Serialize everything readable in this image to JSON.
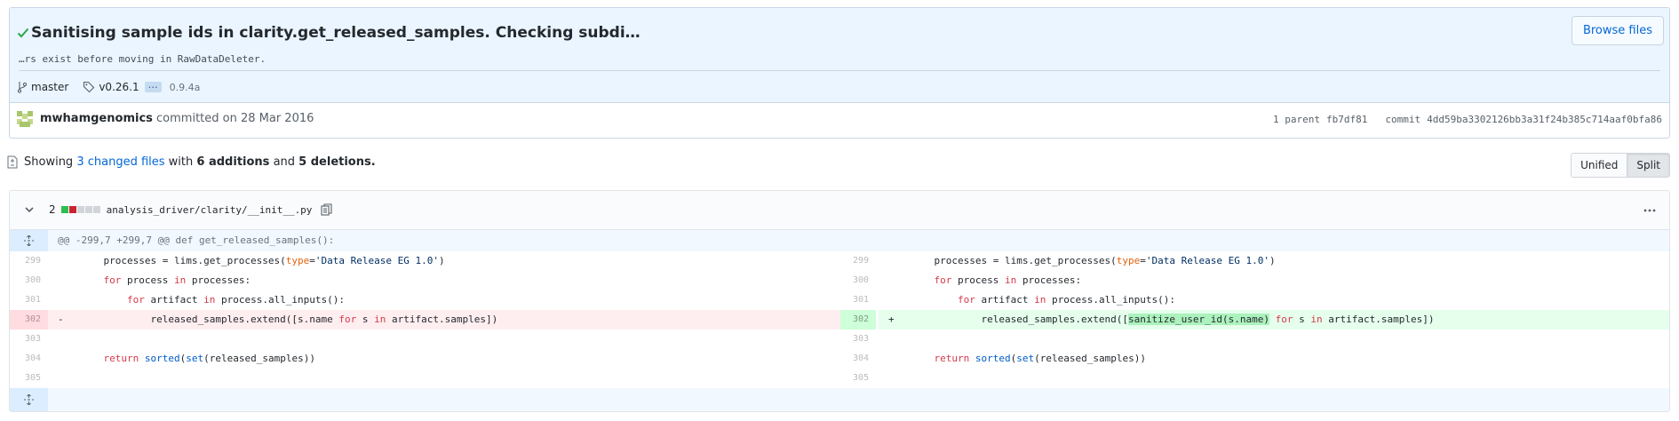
{
  "commit": {
    "title": "Sanitising sample ids in clarity.get_released_samples. Checking subdi…",
    "description": "…rs exist before moving in RawDataDeleter.",
    "browse_files_label": "Browse files",
    "branch": "master",
    "tag": "v0.26.1",
    "tag_ellipsis": "…",
    "tag_extra": "0.9.4a",
    "author": "mwhamgenomics",
    "committed_text": "committed on 28 Mar 2016",
    "parent_label": "1 parent",
    "parent_sha": "fb7df81",
    "commit_label": "commit",
    "commit_sha": "4dd59ba3302126bb3a31f24b385c714aaf0bfa86"
  },
  "toc": {
    "showing": "Showing",
    "changed_files": "3 changed files",
    "with": "with",
    "additions": "6 additions",
    "and": "and",
    "deletions": "5 deletions."
  },
  "view_toggle": {
    "unified": "Unified",
    "split": "Split",
    "selected": "Split"
  },
  "file": {
    "change_count": "2",
    "diffstat": [
      "added",
      "deleted",
      "neutral",
      "neutral",
      "neutral"
    ],
    "path": "analysis_driver/clarity/__init__.py",
    "hunk_header": "@@ -299,7 +299,7 @@ def get_released_samples():",
    "left_lines": [
      {
        "num": "299",
        "type": "context"
      },
      {
        "num": "300",
        "type": "context"
      },
      {
        "num": "301",
        "type": "context"
      },
      {
        "num": "302",
        "type": "del",
        "marker": "-"
      },
      {
        "num": "303",
        "type": "context"
      },
      {
        "num": "304",
        "type": "context"
      },
      {
        "num": "305",
        "type": "context"
      }
    ],
    "right_lines": [
      {
        "num": "299",
        "type": "context"
      },
      {
        "num": "300",
        "type": "context"
      },
      {
        "num": "301",
        "type": "context"
      },
      {
        "num": "302",
        "type": "add",
        "marker": "+"
      },
      {
        "num": "303",
        "type": "context"
      },
      {
        "num": "304",
        "type": "context"
      },
      {
        "num": "305",
        "type": "context"
      }
    ],
    "code": {
      "l299": [
        "    processes = lims.get_processes(",
        "type",
        "=",
        "'Data Release EG 1.0'",
        ")"
      ],
      "l300": [
        "    ",
        "for",
        " process ",
        "in",
        " processes:"
      ],
      "l301": [
        "        ",
        "for",
        " artifact ",
        "in",
        " process.all_inputs():"
      ],
      "l302_old": [
        "            released_samples.extend([s.name ",
        "for",
        " s ",
        "in",
        " artifact.samples])"
      ],
      "l302_new": [
        "            released_samples.extend([",
        "sanitize_user_id(s.name)",
        " ",
        "for",
        " s ",
        "in",
        " artifact.samples])"
      ],
      "l304": [
        "    ",
        "return",
        " ",
        "sorted",
        "(",
        "set",
        "(released_samples))"
      ]
    }
  },
  "colors": {
    "added": "#2cbe4e",
    "deleted": "#cb2431",
    "neutral": "#d1d5da",
    "link": "#0366d6"
  }
}
